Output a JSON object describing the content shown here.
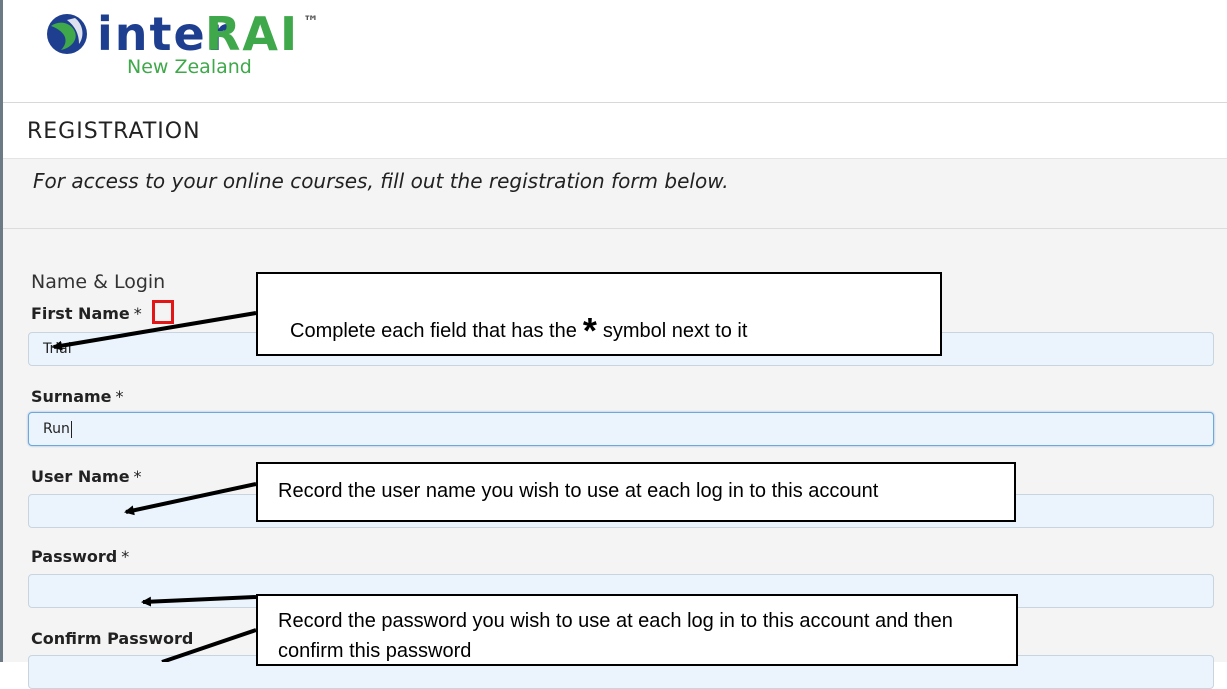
{
  "header": {
    "logo_main": "inter",
    "logo_accent": "RAI",
    "logo_trademark": "™",
    "logo_subtitle": "New Zealand"
  },
  "page": {
    "title": "REGISTRATION",
    "intro": "For access to your online courses, fill out the registration form below."
  },
  "form": {
    "section_title": "Name & Login",
    "required_marker": "*",
    "fields": [
      {
        "label": "First Name",
        "value": "Trial"
      },
      {
        "label": "Surname",
        "value": "Run"
      },
      {
        "label": "User Name",
        "value": ""
      },
      {
        "label": "Password",
        "value": ""
      },
      {
        "label": "Confirm Password",
        "value": ""
      }
    ]
  },
  "callouts": {
    "required_before": "Complete each field that has the",
    "required_star": "*",
    "required_after": "symbol next to it",
    "username": "Record the user name you wish to use at each log in to this account",
    "password": "Record the password you wish to use at each log in to this account and then confirm this password"
  },
  "colors": {
    "logo_blue": "#1e3f8f",
    "logo_green": "#3ea84a",
    "highlight_red": "#e21616",
    "input_bg": "#ebf4fd"
  }
}
